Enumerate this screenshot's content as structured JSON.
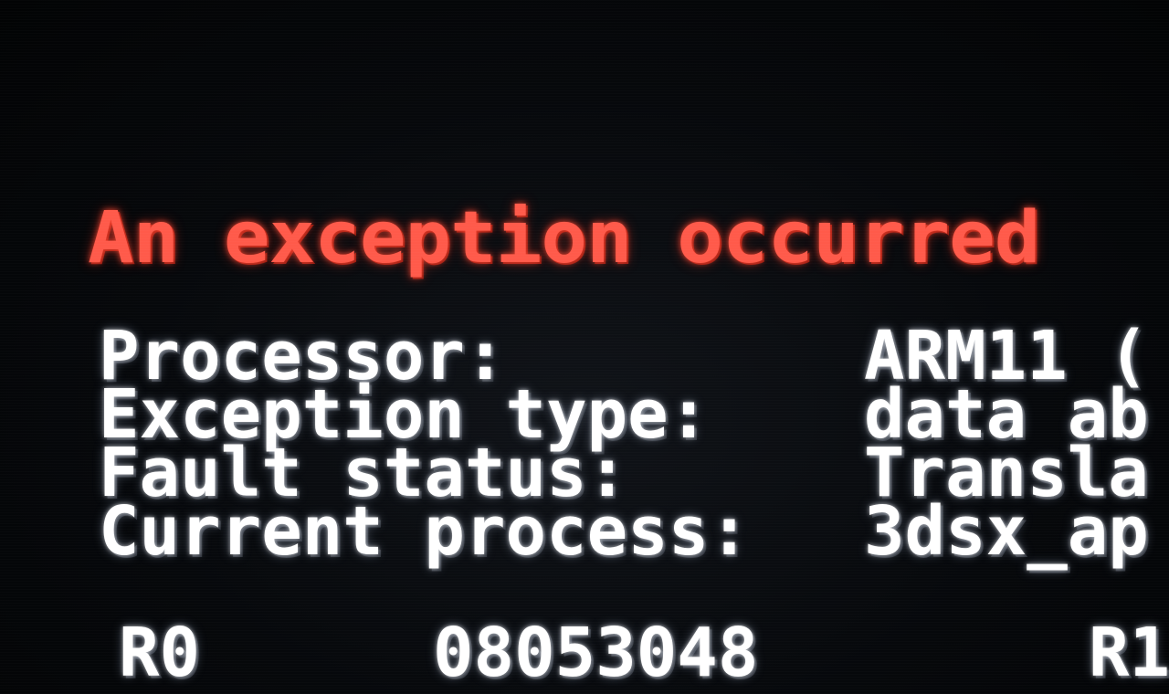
{
  "title": "An exception occurred",
  "info": [
    {
      "label": "Processor:",
      "value": "ARM11 ("
    },
    {
      "label": "Exception type:",
      "value": "data ab"
    },
    {
      "label": "Fault status:",
      "value": "Transla"
    },
    {
      "label": "Current process:",
      "value": "3dsx_ap"
    }
  ],
  "registers": [
    {
      "name": "R0",
      "value": "08053048",
      "name2": "R1"
    }
  ],
  "colors": {
    "title": "#ff5a4a",
    "text": "#ffffff",
    "background": "#05070a"
  }
}
